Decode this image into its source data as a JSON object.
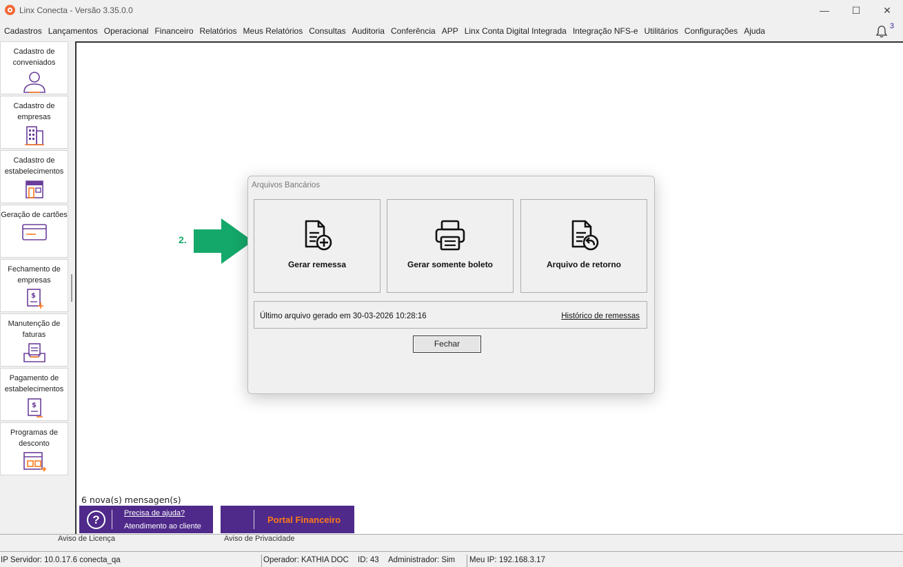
{
  "window": {
    "title": "Linx Conecta - Versão 3.35.0.0",
    "minimize": "—",
    "maximize": "☐",
    "close": "✕"
  },
  "menu": [
    "Cadastros",
    "Lançamentos",
    "Operacional",
    "Financeiro",
    "Relatórios",
    "Meus Relatórios",
    "Consultas",
    "Auditoria",
    "Conferência",
    "APP",
    "Linx Conta Digital Integrada",
    "Integração NFS-e",
    "Utilitários",
    "Configurações",
    "Ajuda"
  ],
  "notifications": {
    "count": "3",
    "icon": "bell-icon"
  },
  "sidebar": [
    {
      "label": "Cadastro de conveniados",
      "icon": "user-icon"
    },
    {
      "label": "Cadastro de empresas",
      "icon": "building-icon"
    },
    {
      "label": "Cadastro de estabelecimentos",
      "icon": "storefront-icon"
    },
    {
      "label": "Geração de cartões",
      "icon": "card-icon"
    },
    {
      "label": "Fechamento de empresas",
      "icon": "invoice-add-icon"
    },
    {
      "label": "Manutenção de faturas",
      "icon": "inbox-tray-icon"
    },
    {
      "label": "Pagamento de estabelecimentos",
      "icon": "payment-doc-icon"
    },
    {
      "label": "Programas de desconto",
      "icon": "discount-program-icon"
    }
  ],
  "annotation": {
    "step": "2.",
    "color": "#14a86a"
  },
  "dialog": {
    "title": "Arquivos Bancários",
    "actions": [
      {
        "label": "Gerar remessa",
        "icon": "document-add-icon"
      },
      {
        "label": "Gerar somente boleto",
        "icon": "printer-icon"
      },
      {
        "label": "Arquivo de retorno",
        "icon": "document-return-icon"
      }
    ],
    "last_file": "Último arquivo gerado em 30-03-2026 10:28:16",
    "history_link": "Histórico de remessas",
    "close_label": "Fechar"
  },
  "messages": {
    "count_text": "6 nova(s) mensagen(s)"
  },
  "help": {
    "line1": "Precisa de ajuda?",
    "line2": "Atendimento ao cliente"
  },
  "portal": {
    "label": "Portal Financeiro"
  },
  "bottom_strip": {
    "left": "Aviso de Licença",
    "right": "Aviso de Privacidade"
  },
  "status": {
    "server": "IP Servidor: 10.0.17.6 conecta_qa",
    "operator": "Operador: KATHIA DOC",
    "id": "ID: 43",
    "admin": "Administrador: Sim",
    "ip": "Meu IP: 192.168.3.17"
  },
  "colors": {
    "brand_purple": "#4f2a8a",
    "brand_orange": "#ff7a1a",
    "icon_purple": "#6a3d9a"
  }
}
